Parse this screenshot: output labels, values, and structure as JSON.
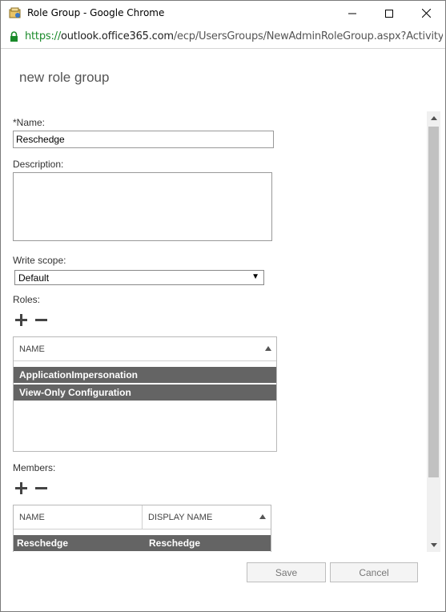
{
  "window": {
    "title": "Role Group - Google Chrome",
    "url_protocol": "https://",
    "url_host": "outlook.office365.com",
    "url_path": "/ecp/UsersGroups/NewAdminRoleGroup.aspx?Activity"
  },
  "dialog": {
    "title": "new role group"
  },
  "form": {
    "name_label": "*Name:",
    "name_value": "Reschedge",
    "description_label": "Description:",
    "description_value": "",
    "write_scope_label": "Write scope:",
    "write_scope_value": "Default",
    "roles_label": "Roles:",
    "members_label": "Members:"
  },
  "roles_table": {
    "columns": [
      "NAME"
    ],
    "rows": [
      {
        "name": "ApplicationImpersonation"
      },
      {
        "name": "View-Only Configuration"
      }
    ]
  },
  "members_table": {
    "columns": [
      "NAME",
      "DISPLAY NAME"
    ],
    "rows": [
      {
        "name": "Reschedge",
        "display_name": "Reschedge"
      }
    ]
  },
  "buttons": {
    "save": "Save",
    "cancel": "Cancel"
  },
  "colors": {
    "selected_row": "#646464",
    "secure_green": "#1a8a2a"
  }
}
